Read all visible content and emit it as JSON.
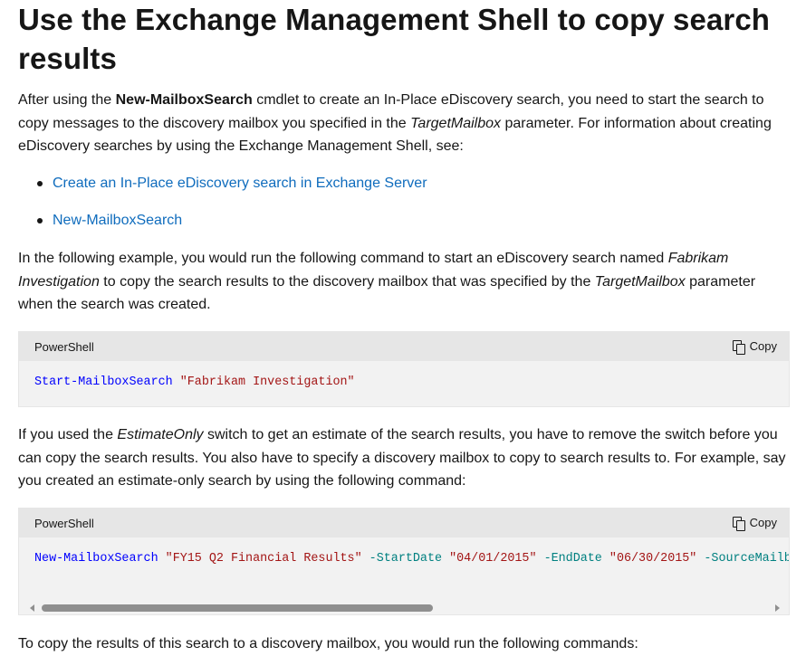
{
  "heading": "Use the Exchange Management Shell to copy search results",
  "para1": {
    "t1": "After using the ",
    "b1": "New-MailboxSearch",
    "t2": " cmdlet to create an In-Place eDiscovery search, you need to start the search to copy messages to the discovery mailbox you specified in the ",
    "i1": "TargetMailbox",
    "t3": " parameter. For information about creating eDiscovery searches by using the Exchange Management Shell, see:"
  },
  "links": [
    {
      "label": "Create an In-Place eDiscovery search in Exchange Server"
    },
    {
      "label": "New-MailboxSearch"
    }
  ],
  "para2": {
    "t1": "In the following example, you would run the following command to start an eDiscovery search named ",
    "i1": "Fabrikam Investigation",
    "t2": " to copy the search results to the discovery mailbox that was specified by the ",
    "i2": "TargetMailbox",
    "t3": " parameter when the search was created."
  },
  "code1": {
    "lang": "PowerShell",
    "copy_label": "Copy",
    "cmd": "Start-MailboxSearch",
    "arg": "\"Fabrikam Investigation\""
  },
  "para3": {
    "t1": "If you used the ",
    "i1": "EstimateOnly",
    "t2": " switch to get an estimate of the search results, you have to remove the switch before you can copy the search results. You also have to specify a discovery mailbox to copy to search results to. For example, say you created an estimate-only search by using the following command:"
  },
  "code2": {
    "lang": "PowerShell",
    "copy_label": "Copy",
    "cmd": "New-MailboxSearch",
    "arg1": "\"FY15 Q2 Financial Results\"",
    "p1": "-StartDate",
    "arg2": "\"04/01/2015\"",
    "p2": "-EndDate",
    "arg3": "\"06/30/2015\"",
    "p3": "-SourceMailboxes"
  },
  "para4": "To copy the results of this search to a discovery mailbox, you would run the following commands:"
}
